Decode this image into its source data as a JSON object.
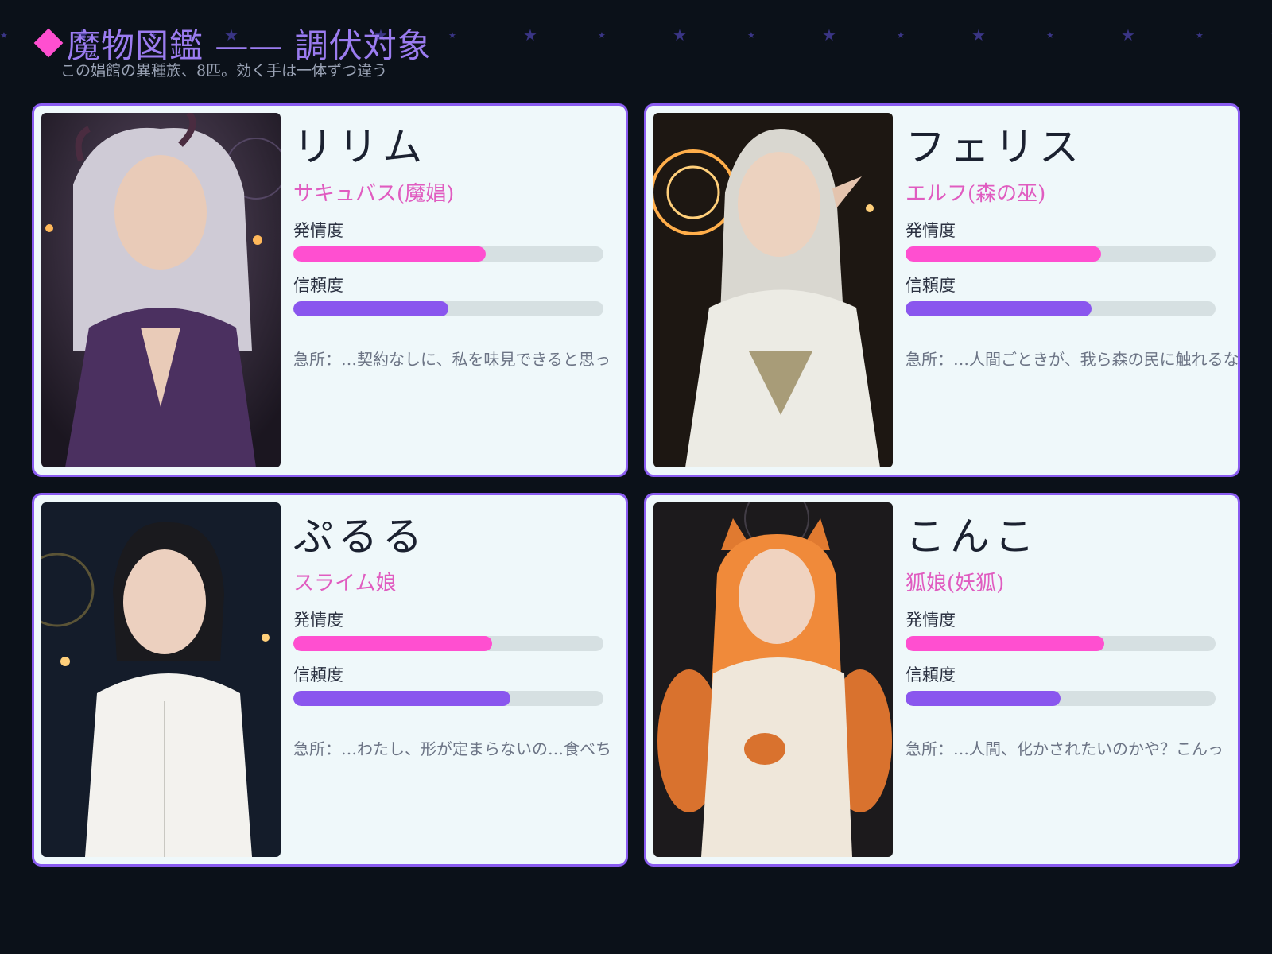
{
  "header": {
    "title": "魔物図鑑 —— 調伏対象",
    "subtitle": "この娼館の異種族、8匹。効く手は一体ずつ違う"
  },
  "colors": {
    "background": "#0b1119",
    "accent_pink": "#ff4fd0",
    "accent_purple": "#8a5cf0",
    "card_bg": "#eff8fa"
  },
  "labels": {
    "lust": "発情度",
    "trust": "信頼度"
  },
  "monsters": [
    {
      "name": "リリム",
      "race": "サキュバス(魔娼)",
      "lust_pct": 62,
      "trust_pct": 50,
      "weak_point": "急所：…契約なしに、私を味見できると思っ",
      "portrait_icon": "succubus-portrait"
    },
    {
      "name": "フェリス",
      "race": "エルフ(森の巫)",
      "lust_pct": 63,
      "trust_pct": 60,
      "weak_point": "急所：…人間ごときが、我ら森の民に触れるな",
      "portrait_icon": "elf-portrait"
    },
    {
      "name": "ぷるる",
      "race": "スライム娘",
      "lust_pct": 64,
      "trust_pct": 70,
      "weak_point": "急所：…わたし、形が定まらないの…食べち",
      "portrait_icon": "slime-girl-portrait"
    },
    {
      "name": "こんこ",
      "race": "狐娘(妖狐)",
      "lust_pct": 64,
      "trust_pct": 50,
      "weak_point": "急所：…人間、化かされたいのかや？こんっ",
      "portrait_icon": "fox-girl-portrait"
    }
  ]
}
